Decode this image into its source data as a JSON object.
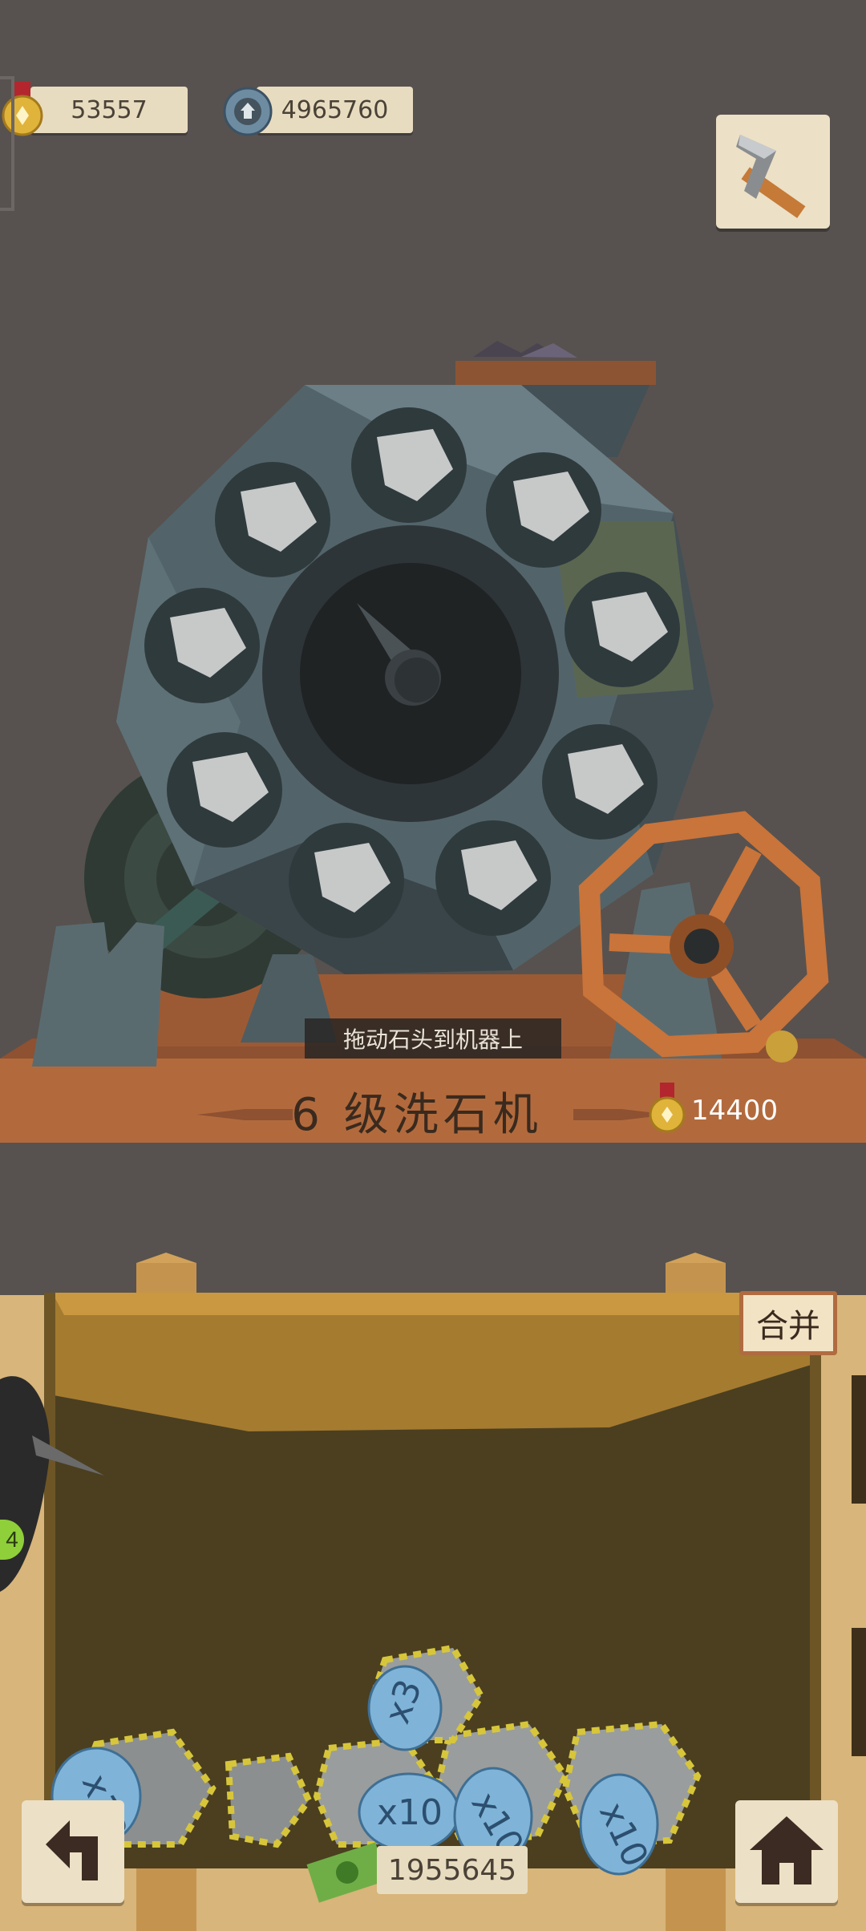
{
  "resources": {
    "medals": "53557",
    "gears": "4965760"
  },
  "machine": {
    "hint": "拖动石头到机器上",
    "title": "6 级洗石机",
    "cost": "14400"
  },
  "bin": {
    "merge_label": "合并",
    "stones": [
      {
        "multiplier": "x13"
      },
      {
        "multiplier": ""
      },
      {
        "multiplier": "x10"
      },
      {
        "multiplier": "x10"
      },
      {
        "multiplier": "x10"
      },
      {
        "multiplier": "x3"
      }
    ]
  },
  "footer": {
    "cash": "1955645"
  },
  "side_badge": "4",
  "colors": {
    "background": "#57524f",
    "wood": "#b06b3f",
    "plaque": "#e8dcc0",
    "bin_dark": "#4a3e1f",
    "valve": "#c9743a"
  },
  "icons": {
    "medal": "medal-icon",
    "gear_coin": "gear-coin-icon",
    "tool": "pickaxe-icon",
    "back": "back-arrow-icon",
    "home": "house-icon",
    "cash": "cash-icon"
  }
}
